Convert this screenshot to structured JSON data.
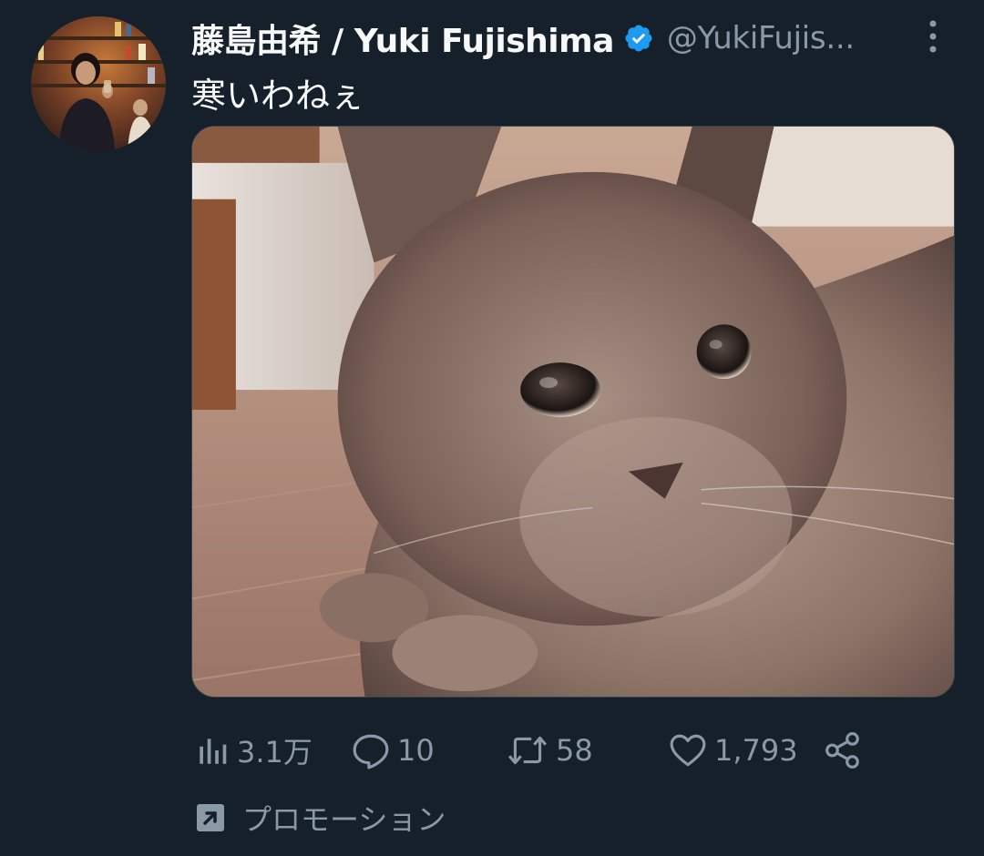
{
  "tweet": {
    "author": {
      "display_name": "藤島由希 / Yuki Fujishima",
      "handle": "@YukiFujis...",
      "verified": true,
      "avatar_icon": "profile-photo"
    },
    "text": "寒いわねぇ",
    "media": {
      "type": "photo",
      "subject": "cat-photo"
    },
    "actions": {
      "views": {
        "icon": "bar-chart-icon",
        "count": "3.1万"
      },
      "replies": {
        "icon": "speech-bubble-icon",
        "count": "10"
      },
      "retweets": {
        "icon": "retweet-icon",
        "count": "58"
      },
      "likes": {
        "icon": "heart-icon",
        "count": "1,793"
      },
      "share": {
        "icon": "share-icon"
      }
    },
    "promotion": {
      "icon": "promoted-arrow-icon",
      "label": "プロモーション"
    }
  },
  "colors": {
    "background": "#15202b",
    "text_primary": "#f7f9f9",
    "text_secondary": "#8b98a5",
    "verified_blue": "#1d9bf0",
    "border": "#38444d"
  }
}
